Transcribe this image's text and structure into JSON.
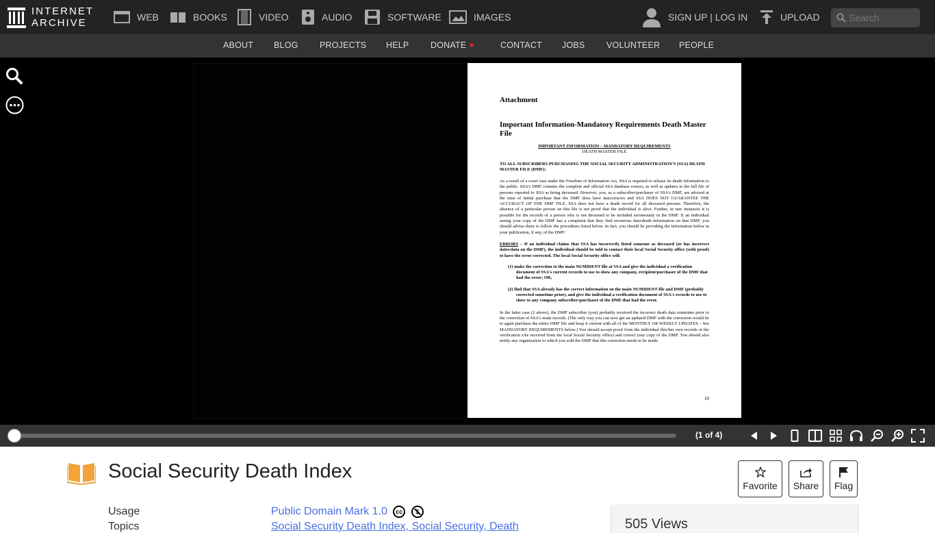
{
  "topnav": {
    "logo_line1": "INTERNET",
    "logo_line2": "ARCHIVE",
    "items": [
      {
        "label": "WEB",
        "icon": "web-icon"
      },
      {
        "label": "BOOKS",
        "icon": "books-icon"
      },
      {
        "label": "VIDEO",
        "icon": "video-icon"
      },
      {
        "label": "AUDIO",
        "icon": "audio-icon"
      },
      {
        "label": "SOFTWARE",
        "icon": "software-icon"
      },
      {
        "label": "IMAGES",
        "icon": "images-icon"
      }
    ],
    "signup_login": "SIGN UP | LOG IN",
    "upload": "UPLOAD",
    "search_placeholder": "Search"
  },
  "subnav": {
    "items": [
      "ABOUT",
      "BLOG",
      "PROJECTS",
      "HELP",
      "DONATE",
      "CONTACT",
      "JOBS",
      "VOLUNTEER",
      "PEOPLE"
    ]
  },
  "document": {
    "attachment": "Attachment",
    "title": "Important Information-Mandatory Requirements Death Master File",
    "center_line1": "IMPORTANT INFORMATION – MANDATORY REQUIREMENTS",
    "center_line2": "DEATH MASTER FILE",
    "heading": "TO ALL SUBSCRIBERS PURCHASING THE SOCIAL SECURITY ADMINISTRATION'S (SSA) DEATH MASTER FILE (DMF):",
    "para1": "As a result of a court case under the Freedom of Information Act, SSA is required to release its death information to the public. SSA's DMF contains the complete and official SSA database extract, as well as updates to the full file of persons reported to SSA as being deceased. However, you, as a subscriber/purchaser of SSA's DMF, are advised at the time of initial purchase that the DMF does have inaccuracies and SSA DOES NOT GUARANTEE THE ACCURACY OF THE DMF FILE. SSA does not have a death record for all deceased persons. Therefore, the absence of a particular person on this file is not proof that the individual is alive. Further, in rare instances it is possible for the records of a person who is not deceased to be included erroneously in the DMF. If an individual seeing your copy of the DMF has a complaint that they find erroneous data/death information on that DMF, you should advise them to follow the procedures listed below. In fact, you should be providing the information below in your publication, if any, of the DMF:",
    "errors_label": "ERRORS",
    "errors_text": " – If an individual claims that SSA has incorrectly listed someone as deceased (or has incorrect dates/data on the DMF), the individual should be told to contact their local Social Security office (with proof) to have the error corrected. The local Social Security office will:",
    "item1": "(1)  make the correction to the main NUMIDENT file at SSA and give the individual a verification document of SSA's current records to use to show any company, recipient/purchaser of the DMF that had the error; OR,",
    "item2": "(2)  find that SSA already has the correct information on the main NUMIDENT file and DMF (probably corrected sometime prior), and give the individual a verification document of SSA's records to use to show to any company subscriber/purchaser of the DMF that had the error.",
    "para2": "In the latter case (2 above), the DMF subscriber (you) probably received the incorrect death data sometime prior to the correction of SSA's main records. (The only way you can now get an updated DMF with the correction would be to again purchase the entire DMF file and keep it current with all of the MONTHLY OR WEEKLY UPDATES – See MANDATORY REQUIREMENTS below.) You should accept proof from the individual (his/her own records or the verification s/he received from the local Social Security office) and correct your copy of the DMF. You should also notify any organization to which you sold the DMF that this correction needs to be made.",
    "page_number": "10"
  },
  "reader": {
    "page_count": "(1 of 4)",
    "progress_fraction": 0
  },
  "item": {
    "title": "Social Security Death Index",
    "favorite": "Favorite",
    "share": "Share",
    "flag": "Flag",
    "usage_label": "Usage",
    "usage_value": "Public Domain Mark 1.0",
    "topics_label": "Topics",
    "topics_value": "Social Security Death Index, Social Security, Death",
    "views": "505 Views"
  },
  "colors": {
    "topnav_bg": "#232323",
    "subnav_bg": "#333333",
    "link": "#4a6ee0",
    "heart": "#e0232b",
    "books_icon": "#f2a33a"
  }
}
